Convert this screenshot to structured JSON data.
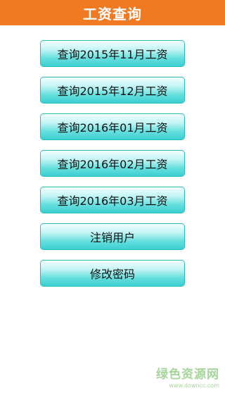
{
  "header": {
    "title": "工资查询"
  },
  "menu": {
    "items": [
      {
        "label": "查询2015年11月工资"
      },
      {
        "label": "查询2015年12月工资"
      },
      {
        "label": "查询2016年01月工资"
      },
      {
        "label": "查询2016年02月工资"
      },
      {
        "label": "查询2016年03月工资"
      },
      {
        "label": "注销用户"
      },
      {
        "label": "修改密码"
      }
    ]
  },
  "watermark": {
    "title": "绿色资源网",
    "url": "www.downcc.com"
  },
  "colors": {
    "header_bg": "#f07a22",
    "button_border": "#22bcbc",
    "button_gradient_bottom": "#3ccfcf",
    "watermark": "#a6d59a"
  }
}
